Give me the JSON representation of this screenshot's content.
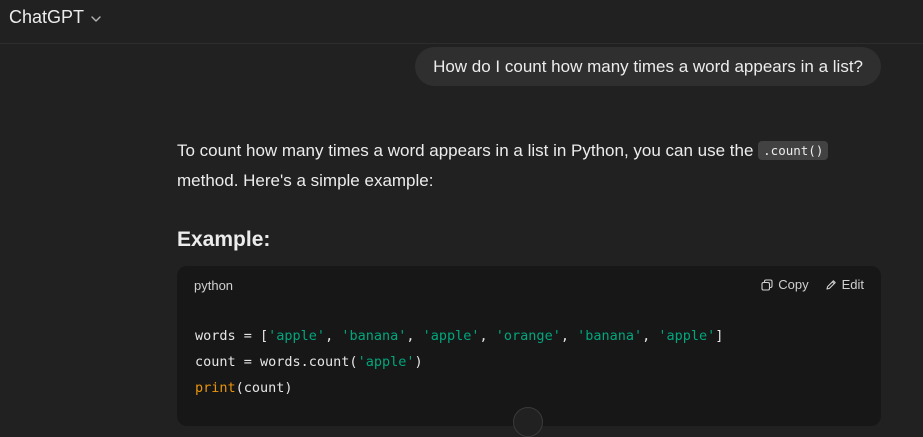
{
  "header": {
    "model_name": "ChatGPT"
  },
  "user_message": "How do I count how many times a word appears in a list?",
  "assistant": {
    "intro_before": "To count how many times a word appears in a list in Python, you can use the ",
    "intro_code": ".count()",
    "intro_after": "method. Here's a simple example:",
    "heading": "Example:",
    "code_block": {
      "language": "python",
      "copy_label": "Copy",
      "edit_label": "Edit",
      "lines": [
        {
          "tokens": [
            {
              "t": "words = [",
              "c": "plain"
            },
            {
              "t": "'apple'",
              "c": "str"
            },
            {
              "t": ", ",
              "c": "plain"
            },
            {
              "t": "'banana'",
              "c": "str"
            },
            {
              "t": ", ",
              "c": "plain"
            },
            {
              "t": "'apple'",
              "c": "str"
            },
            {
              "t": ", ",
              "c": "plain"
            },
            {
              "t": "'orange'",
              "c": "str"
            },
            {
              "t": ", ",
              "c": "plain"
            },
            {
              "t": "'banana'",
              "c": "str"
            },
            {
              "t": ", ",
              "c": "plain"
            },
            {
              "t": "'apple'",
              "c": "str"
            },
            {
              "t": "]",
              "c": "plain"
            }
          ]
        },
        {
          "tokens": [
            {
              "t": "count = words.count(",
              "c": "plain"
            },
            {
              "t": "'apple'",
              "c": "str"
            },
            {
              "t": ")",
              "c": "plain"
            }
          ]
        },
        {
          "tokens": [
            {
              "t": "print",
              "c": "fn"
            },
            {
              "t": "(count)",
              "c": "plain"
            }
          ]
        }
      ]
    }
  },
  "colors": {
    "background": "#212121",
    "user_bubble": "#2f2f2f",
    "code_background": "#171717",
    "string_token": "#00a67d",
    "builtin_token": "#e9950c"
  },
  "icons": {
    "model_menu": "chevron-down-icon",
    "copy": "copy-icon",
    "edit": "pencil-icon",
    "scroll": "scroll-down-button"
  }
}
